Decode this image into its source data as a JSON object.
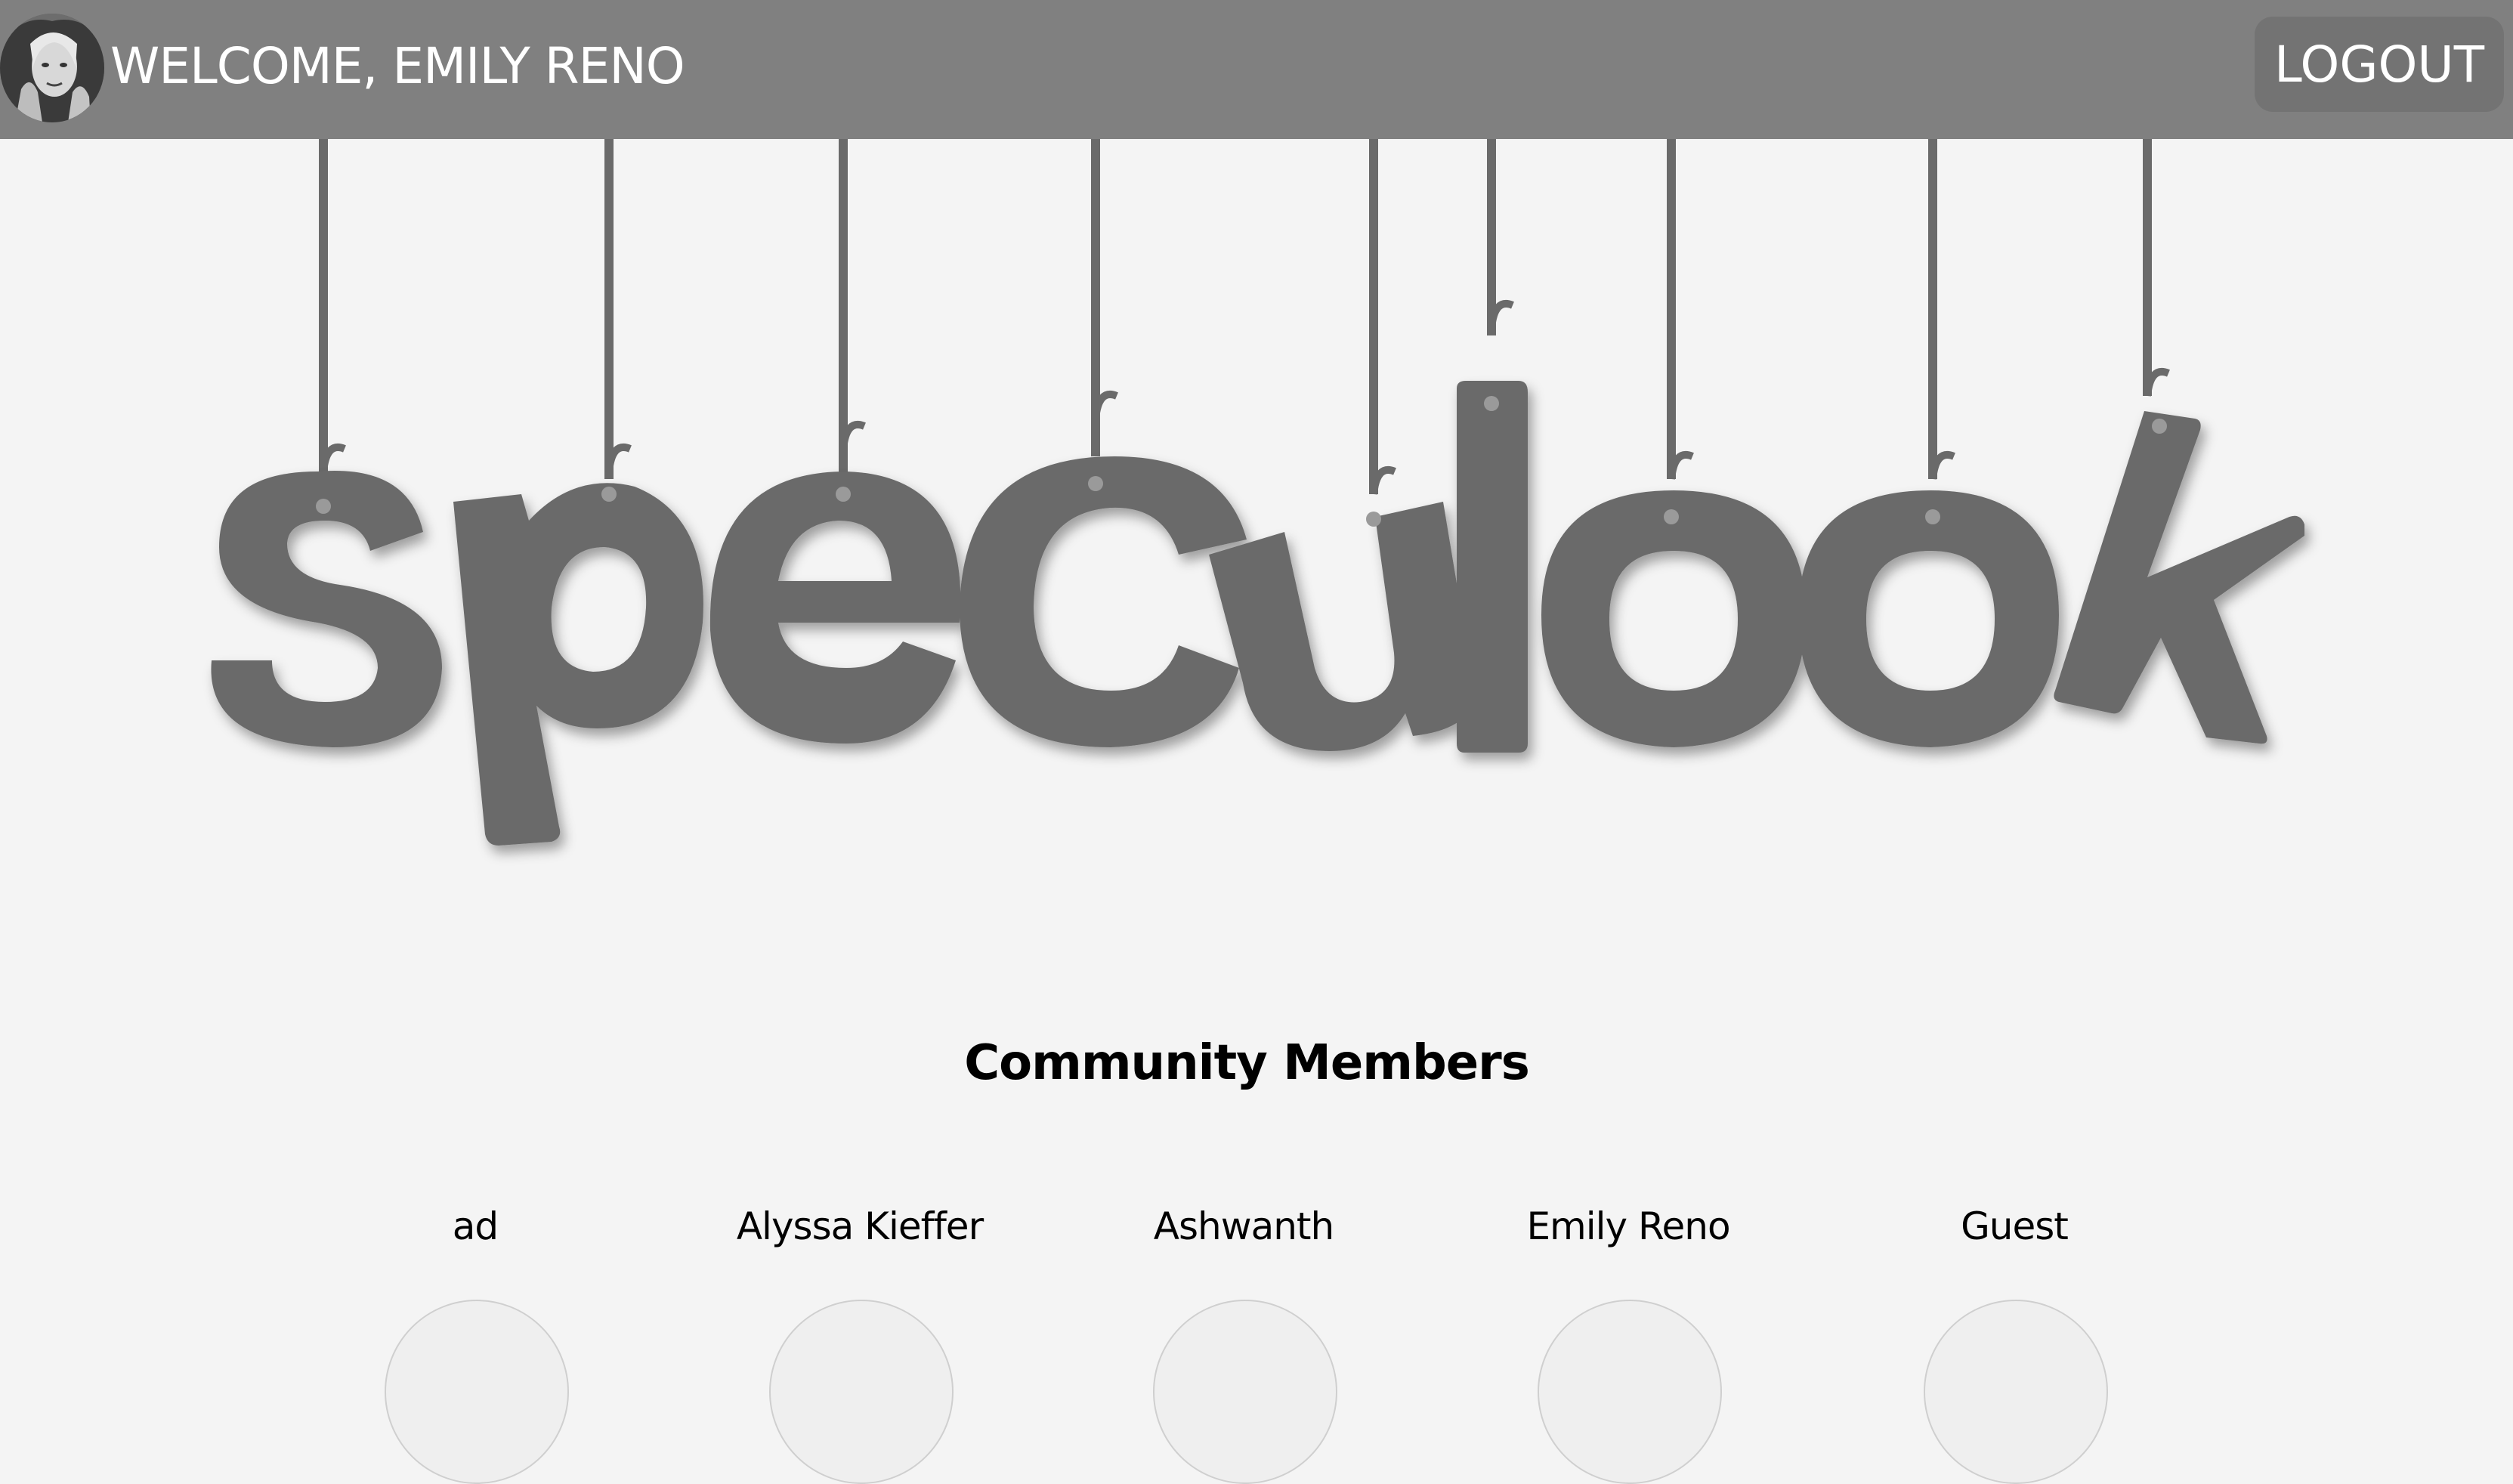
{
  "header": {
    "welcome_text": "WELCOME, EMILY RENO",
    "logout_label": "LOGOUT"
  },
  "hero": {
    "logo_text": "speculook",
    "colors": {
      "letters": "#6a6a6a",
      "strings": "#6a6a6a"
    }
  },
  "community": {
    "title": "Community Members",
    "members": [
      {
        "name": "ad"
      },
      {
        "name": "Alyssa Kieffer"
      },
      {
        "name": "Ashwanth"
      },
      {
        "name": "Emily Reno"
      },
      {
        "name": "Guest"
      }
    ]
  },
  "colors": {
    "header_bg": "#808080",
    "page_bg": "#f4f4f4",
    "button_bg": "#737373"
  }
}
